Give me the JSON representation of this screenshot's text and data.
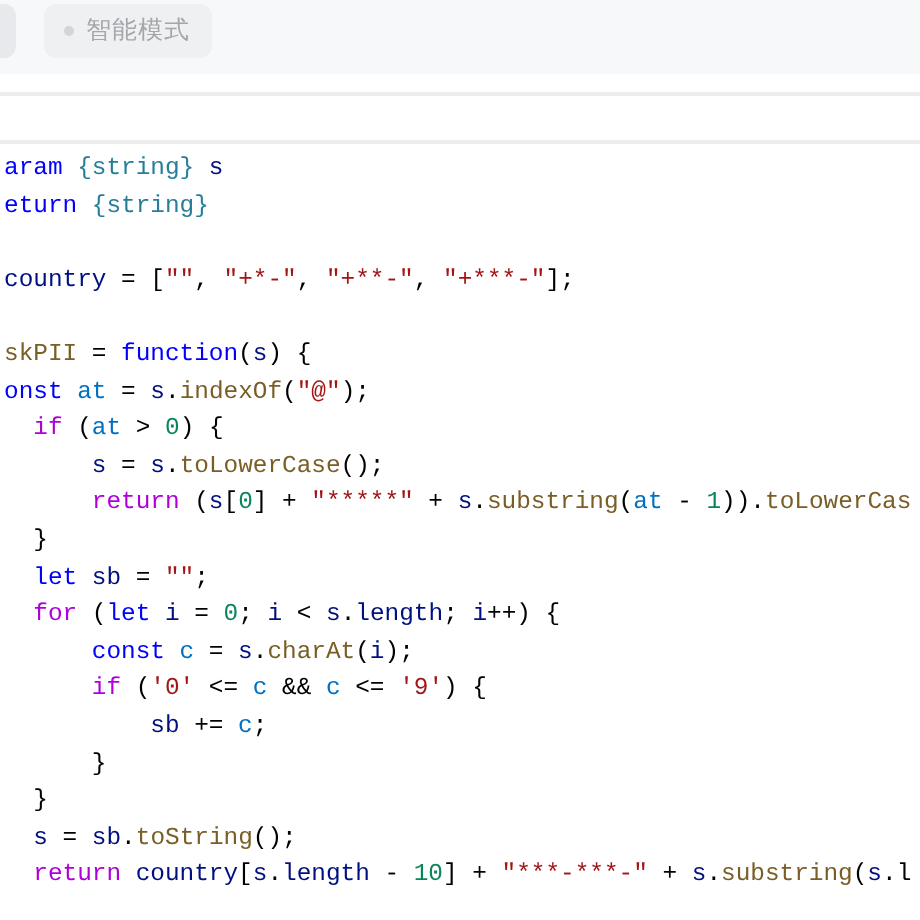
{
  "toolbar": {
    "chips": [
      {
        "selected": false
      },
      {
        "label": "智能模式",
        "selected": false
      }
    ]
  },
  "code": [
    {
      "kind": "code",
      "tokens": [
        {
          "text": "aram ",
          "kind": "kw"
        },
        {
          "text": "{string}",
          "kind": "type"
        },
        {
          "text": " s",
          "kind": "var"
        }
      ]
    },
    {
      "kind": "code",
      "tokens": [
        {
          "text": "eturn ",
          "kind": "kw"
        },
        {
          "text": "{string}",
          "kind": "type"
        }
      ]
    },
    {
      "kind": "blank"
    },
    {
      "kind": "code",
      "tokens": [
        {
          "text": "country",
          "kind": "var"
        },
        {
          "text": " = [",
          "kind": "plain"
        },
        {
          "text": "\"\"",
          "kind": "str"
        },
        {
          "text": ", ",
          "kind": "plain"
        },
        {
          "text": "\"+*-\"",
          "kind": "str"
        },
        {
          "text": ", ",
          "kind": "plain"
        },
        {
          "text": "\"+**-\"",
          "kind": "str"
        },
        {
          "text": ", ",
          "kind": "plain"
        },
        {
          "text": "\"+***-\"",
          "kind": "str"
        },
        {
          "text": "];",
          "kind": "plain"
        }
      ]
    },
    {
      "kind": "blank"
    },
    {
      "kind": "code",
      "tokens": [
        {
          "text": "skPII",
          "kind": "fn"
        },
        {
          "text": " = ",
          "kind": "plain"
        },
        {
          "text": "function",
          "kind": "kw"
        },
        {
          "text": "(",
          "kind": "plain"
        },
        {
          "text": "s",
          "kind": "var"
        },
        {
          "text": ") {",
          "kind": "plain"
        }
      ]
    },
    {
      "kind": "code",
      "tokens": [
        {
          "text": "onst ",
          "kind": "kw"
        },
        {
          "text": "at",
          "kind": "const"
        },
        {
          "text": " = ",
          "kind": "plain"
        },
        {
          "text": "s",
          "kind": "var"
        },
        {
          "text": ".",
          "kind": "plain"
        },
        {
          "text": "indexOf",
          "kind": "fn"
        },
        {
          "text": "(",
          "kind": "plain"
        },
        {
          "text": "\"@\"",
          "kind": "str"
        },
        {
          "text": ");",
          "kind": "plain"
        }
      ]
    },
    {
      "kind": "code",
      "tokens": [
        {
          "text": "  if",
          "kind": "ctrl"
        },
        {
          "text": " (",
          "kind": "plain"
        },
        {
          "text": "at",
          "kind": "const"
        },
        {
          "text": " > ",
          "kind": "plain"
        },
        {
          "text": "0",
          "kind": "num"
        },
        {
          "text": ") {",
          "kind": "plain"
        }
      ]
    },
    {
      "kind": "code",
      "tokens": [
        {
          "text": "      s",
          "kind": "var"
        },
        {
          "text": " = ",
          "kind": "plain"
        },
        {
          "text": "s",
          "kind": "var"
        },
        {
          "text": ".",
          "kind": "plain"
        },
        {
          "text": "toLowerCase",
          "kind": "fn"
        },
        {
          "text": "();",
          "kind": "plain"
        }
      ]
    },
    {
      "kind": "code",
      "tokens": [
        {
          "text": "      return",
          "kind": "ctrl"
        },
        {
          "text": " (",
          "kind": "plain"
        },
        {
          "text": "s",
          "kind": "var"
        },
        {
          "text": "[",
          "kind": "plain"
        },
        {
          "text": "0",
          "kind": "num"
        },
        {
          "text": "] + ",
          "kind": "plain"
        },
        {
          "text": "\"*****\"",
          "kind": "str"
        },
        {
          "text": " + ",
          "kind": "plain"
        },
        {
          "text": "s",
          "kind": "var"
        },
        {
          "text": ".",
          "kind": "plain"
        },
        {
          "text": "substring",
          "kind": "fn"
        },
        {
          "text": "(",
          "kind": "plain"
        },
        {
          "text": "at",
          "kind": "const"
        },
        {
          "text": " - ",
          "kind": "plain"
        },
        {
          "text": "1",
          "kind": "num"
        },
        {
          "text": ")).",
          "kind": "plain"
        },
        {
          "text": "toLowerCas",
          "kind": "fn"
        }
      ]
    },
    {
      "kind": "code",
      "tokens": [
        {
          "text": "  }",
          "kind": "plain"
        }
      ]
    },
    {
      "kind": "code",
      "tokens": [
        {
          "text": "  let ",
          "kind": "kw"
        },
        {
          "text": "sb",
          "kind": "var"
        },
        {
          "text": " = ",
          "kind": "plain"
        },
        {
          "text": "\"\"",
          "kind": "str"
        },
        {
          "text": ";",
          "kind": "plain"
        }
      ]
    },
    {
      "kind": "code",
      "tokens": [
        {
          "text": "  for",
          "kind": "ctrl"
        },
        {
          "text": " (",
          "kind": "plain"
        },
        {
          "text": "let ",
          "kind": "kw"
        },
        {
          "text": "i",
          "kind": "var"
        },
        {
          "text": " = ",
          "kind": "plain"
        },
        {
          "text": "0",
          "kind": "num"
        },
        {
          "text": "; ",
          "kind": "plain"
        },
        {
          "text": "i",
          "kind": "var"
        },
        {
          "text": " < ",
          "kind": "plain"
        },
        {
          "text": "s",
          "kind": "var"
        },
        {
          "text": ".",
          "kind": "plain"
        },
        {
          "text": "length",
          "kind": "var"
        },
        {
          "text": "; ",
          "kind": "plain"
        },
        {
          "text": "i",
          "kind": "var"
        },
        {
          "text": "++) {",
          "kind": "plain"
        }
      ]
    },
    {
      "kind": "code",
      "tokens": [
        {
          "text": "      const ",
          "kind": "kw"
        },
        {
          "text": "c",
          "kind": "const"
        },
        {
          "text": " = ",
          "kind": "plain"
        },
        {
          "text": "s",
          "kind": "var"
        },
        {
          "text": ".",
          "kind": "plain"
        },
        {
          "text": "charAt",
          "kind": "fn"
        },
        {
          "text": "(",
          "kind": "plain"
        },
        {
          "text": "i",
          "kind": "var"
        },
        {
          "text": ");",
          "kind": "plain"
        }
      ]
    },
    {
      "kind": "code",
      "tokens": [
        {
          "text": "      if",
          "kind": "ctrl"
        },
        {
          "text": " (",
          "kind": "plain"
        },
        {
          "text": "'0'",
          "kind": "str"
        },
        {
          "text": " <= ",
          "kind": "plain"
        },
        {
          "text": "c",
          "kind": "const"
        },
        {
          "text": " && ",
          "kind": "plain"
        },
        {
          "text": "c",
          "kind": "const"
        },
        {
          "text": " <= ",
          "kind": "plain"
        },
        {
          "text": "'9'",
          "kind": "str"
        },
        {
          "text": ") {",
          "kind": "plain"
        }
      ]
    },
    {
      "kind": "code",
      "tokens": [
        {
          "text": "          sb",
          "kind": "var"
        },
        {
          "text": " += ",
          "kind": "plain"
        },
        {
          "text": "c",
          "kind": "const"
        },
        {
          "text": ";",
          "kind": "plain"
        }
      ]
    },
    {
      "kind": "code",
      "tokens": [
        {
          "text": "      }",
          "kind": "plain"
        }
      ]
    },
    {
      "kind": "code",
      "tokens": [
        {
          "text": "  }",
          "kind": "plain"
        }
      ]
    },
    {
      "kind": "code",
      "tokens": [
        {
          "text": "  s",
          "kind": "var"
        },
        {
          "text": " = ",
          "kind": "plain"
        },
        {
          "text": "sb",
          "kind": "var"
        },
        {
          "text": ".",
          "kind": "plain"
        },
        {
          "text": "toString",
          "kind": "fn"
        },
        {
          "text": "();",
          "kind": "plain"
        }
      ]
    },
    {
      "kind": "code",
      "tokens": [
        {
          "text": "  return",
          "kind": "ctrl"
        },
        {
          "text": " country",
          "kind": "var"
        },
        {
          "text": "[",
          "kind": "plain"
        },
        {
          "text": "s",
          "kind": "var"
        },
        {
          "text": ".",
          "kind": "plain"
        },
        {
          "text": "length",
          "kind": "var"
        },
        {
          "text": " - ",
          "kind": "plain"
        },
        {
          "text": "10",
          "kind": "num"
        },
        {
          "text": "] + ",
          "kind": "plain"
        },
        {
          "text": "\"***-***-\"",
          "kind": "str"
        },
        {
          "text": " + ",
          "kind": "plain"
        },
        {
          "text": "s",
          "kind": "var"
        },
        {
          "text": ".",
          "kind": "plain"
        },
        {
          "text": "substring",
          "kind": "fn"
        },
        {
          "text": "(",
          "kind": "plain"
        },
        {
          "text": "s",
          "kind": "var"
        },
        {
          "text": ".l",
          "kind": "plain"
        }
      ]
    }
  ]
}
